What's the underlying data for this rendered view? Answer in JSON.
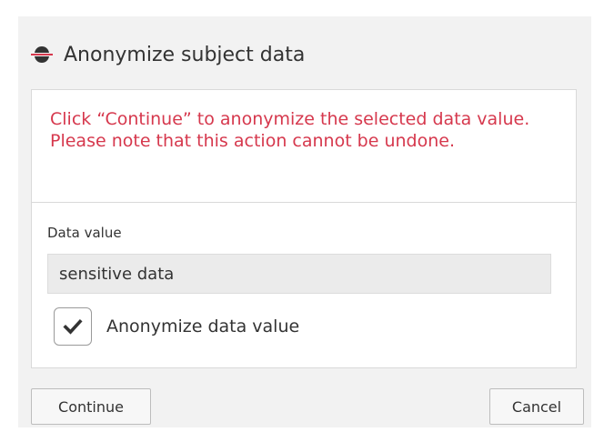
{
  "dialog": {
    "title": "Anonymize subject data",
    "title_icon": "anonymize-icon",
    "warning": "Click “Continue” to anonymize the selected data value. Please note that this action cannot be undone.",
    "field": {
      "label": "Data value",
      "value": "sensitive data"
    },
    "checkbox": {
      "label": "Anonymize data value",
      "checked": true
    },
    "buttons": {
      "continue": "Continue",
      "cancel": "Cancel"
    }
  },
  "colors": {
    "warning_text": "#d6384d",
    "icon_strike": "#d6384d"
  }
}
